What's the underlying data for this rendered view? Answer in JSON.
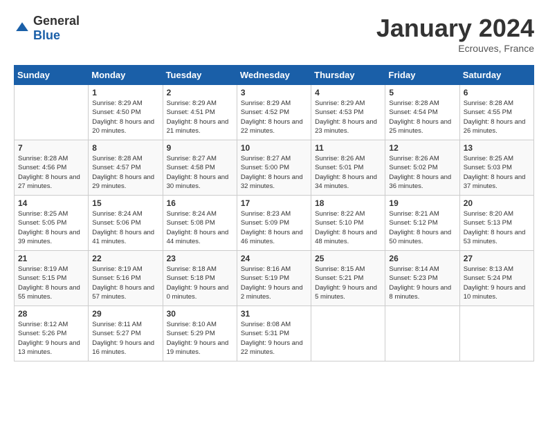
{
  "header": {
    "logo_general": "General",
    "logo_blue": "Blue",
    "month_title": "January 2024",
    "location": "Ecrouves, France"
  },
  "days_of_week": [
    "Sunday",
    "Monday",
    "Tuesday",
    "Wednesday",
    "Thursday",
    "Friday",
    "Saturday"
  ],
  "weeks": [
    [
      {
        "day": "",
        "sunrise": "",
        "sunset": "",
        "daylight": ""
      },
      {
        "day": "1",
        "sunrise": "Sunrise: 8:29 AM",
        "sunset": "Sunset: 4:50 PM",
        "daylight": "Daylight: 8 hours and 20 minutes."
      },
      {
        "day": "2",
        "sunrise": "Sunrise: 8:29 AM",
        "sunset": "Sunset: 4:51 PM",
        "daylight": "Daylight: 8 hours and 21 minutes."
      },
      {
        "day": "3",
        "sunrise": "Sunrise: 8:29 AM",
        "sunset": "Sunset: 4:52 PM",
        "daylight": "Daylight: 8 hours and 22 minutes."
      },
      {
        "day": "4",
        "sunrise": "Sunrise: 8:29 AM",
        "sunset": "Sunset: 4:53 PM",
        "daylight": "Daylight: 8 hours and 23 minutes."
      },
      {
        "day": "5",
        "sunrise": "Sunrise: 8:28 AM",
        "sunset": "Sunset: 4:54 PM",
        "daylight": "Daylight: 8 hours and 25 minutes."
      },
      {
        "day": "6",
        "sunrise": "Sunrise: 8:28 AM",
        "sunset": "Sunset: 4:55 PM",
        "daylight": "Daylight: 8 hours and 26 minutes."
      }
    ],
    [
      {
        "day": "7",
        "sunrise": "Sunrise: 8:28 AM",
        "sunset": "Sunset: 4:56 PM",
        "daylight": "Daylight: 8 hours and 27 minutes."
      },
      {
        "day": "8",
        "sunrise": "Sunrise: 8:28 AM",
        "sunset": "Sunset: 4:57 PM",
        "daylight": "Daylight: 8 hours and 29 minutes."
      },
      {
        "day": "9",
        "sunrise": "Sunrise: 8:27 AM",
        "sunset": "Sunset: 4:58 PM",
        "daylight": "Daylight: 8 hours and 30 minutes."
      },
      {
        "day": "10",
        "sunrise": "Sunrise: 8:27 AM",
        "sunset": "Sunset: 5:00 PM",
        "daylight": "Daylight: 8 hours and 32 minutes."
      },
      {
        "day": "11",
        "sunrise": "Sunrise: 8:26 AM",
        "sunset": "Sunset: 5:01 PM",
        "daylight": "Daylight: 8 hours and 34 minutes."
      },
      {
        "day": "12",
        "sunrise": "Sunrise: 8:26 AM",
        "sunset": "Sunset: 5:02 PM",
        "daylight": "Daylight: 8 hours and 36 minutes."
      },
      {
        "day": "13",
        "sunrise": "Sunrise: 8:25 AM",
        "sunset": "Sunset: 5:03 PM",
        "daylight": "Daylight: 8 hours and 37 minutes."
      }
    ],
    [
      {
        "day": "14",
        "sunrise": "Sunrise: 8:25 AM",
        "sunset": "Sunset: 5:05 PM",
        "daylight": "Daylight: 8 hours and 39 minutes."
      },
      {
        "day": "15",
        "sunrise": "Sunrise: 8:24 AM",
        "sunset": "Sunset: 5:06 PM",
        "daylight": "Daylight: 8 hours and 41 minutes."
      },
      {
        "day": "16",
        "sunrise": "Sunrise: 8:24 AM",
        "sunset": "Sunset: 5:08 PM",
        "daylight": "Daylight: 8 hours and 44 minutes."
      },
      {
        "day": "17",
        "sunrise": "Sunrise: 8:23 AM",
        "sunset": "Sunset: 5:09 PM",
        "daylight": "Daylight: 8 hours and 46 minutes."
      },
      {
        "day": "18",
        "sunrise": "Sunrise: 8:22 AM",
        "sunset": "Sunset: 5:10 PM",
        "daylight": "Daylight: 8 hours and 48 minutes."
      },
      {
        "day": "19",
        "sunrise": "Sunrise: 8:21 AM",
        "sunset": "Sunset: 5:12 PM",
        "daylight": "Daylight: 8 hours and 50 minutes."
      },
      {
        "day": "20",
        "sunrise": "Sunrise: 8:20 AM",
        "sunset": "Sunset: 5:13 PM",
        "daylight": "Daylight: 8 hours and 53 minutes."
      }
    ],
    [
      {
        "day": "21",
        "sunrise": "Sunrise: 8:19 AM",
        "sunset": "Sunset: 5:15 PM",
        "daylight": "Daylight: 8 hours and 55 minutes."
      },
      {
        "day": "22",
        "sunrise": "Sunrise: 8:19 AM",
        "sunset": "Sunset: 5:16 PM",
        "daylight": "Daylight: 8 hours and 57 minutes."
      },
      {
        "day": "23",
        "sunrise": "Sunrise: 8:18 AM",
        "sunset": "Sunset: 5:18 PM",
        "daylight": "Daylight: 9 hours and 0 minutes."
      },
      {
        "day": "24",
        "sunrise": "Sunrise: 8:16 AM",
        "sunset": "Sunset: 5:19 PM",
        "daylight": "Daylight: 9 hours and 2 minutes."
      },
      {
        "day": "25",
        "sunrise": "Sunrise: 8:15 AM",
        "sunset": "Sunset: 5:21 PM",
        "daylight": "Daylight: 9 hours and 5 minutes."
      },
      {
        "day": "26",
        "sunrise": "Sunrise: 8:14 AM",
        "sunset": "Sunset: 5:23 PM",
        "daylight": "Daylight: 9 hours and 8 minutes."
      },
      {
        "day": "27",
        "sunrise": "Sunrise: 8:13 AM",
        "sunset": "Sunset: 5:24 PM",
        "daylight": "Daylight: 9 hours and 10 minutes."
      }
    ],
    [
      {
        "day": "28",
        "sunrise": "Sunrise: 8:12 AM",
        "sunset": "Sunset: 5:26 PM",
        "daylight": "Daylight: 9 hours and 13 minutes."
      },
      {
        "day": "29",
        "sunrise": "Sunrise: 8:11 AM",
        "sunset": "Sunset: 5:27 PM",
        "daylight": "Daylight: 9 hours and 16 minutes."
      },
      {
        "day": "30",
        "sunrise": "Sunrise: 8:10 AM",
        "sunset": "Sunset: 5:29 PM",
        "daylight": "Daylight: 9 hours and 19 minutes."
      },
      {
        "day": "31",
        "sunrise": "Sunrise: 8:08 AM",
        "sunset": "Sunset: 5:31 PM",
        "daylight": "Daylight: 9 hours and 22 minutes."
      },
      {
        "day": "",
        "sunrise": "",
        "sunset": "",
        "daylight": ""
      },
      {
        "day": "",
        "sunrise": "",
        "sunset": "",
        "daylight": ""
      },
      {
        "day": "",
        "sunrise": "",
        "sunset": "",
        "daylight": ""
      }
    ]
  ]
}
